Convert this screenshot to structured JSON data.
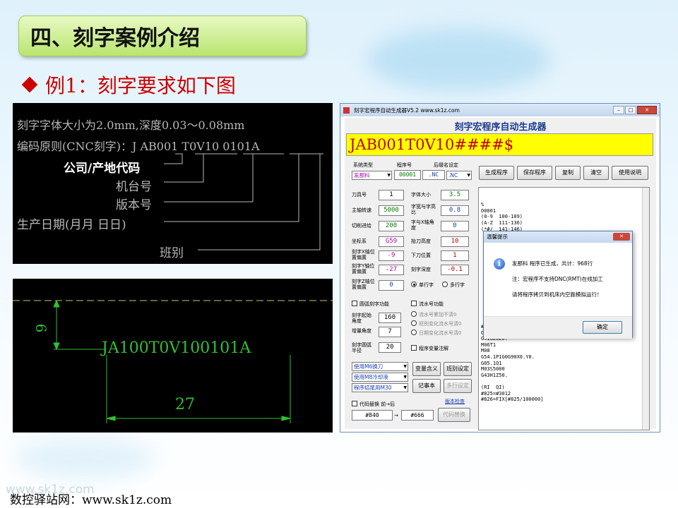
{
  "slide": {
    "title": "四、刻字案例介绍",
    "example_heading": "例1：刻字要求如下图",
    "footer": "数控驿站网：www.sk1z.com",
    "watermark": "www.sk1z.com"
  },
  "figure1": {
    "requirement": "刻字字体大小为2.0mm,深度0.03～0.08mm",
    "code_rule": "编码原则(CNC刻字)：J  AB001  T0V10  0101A",
    "labels": [
      "公司/产地代码",
      "机台号",
      "版本号",
      "生产日期(月月  日日)",
      "班别"
    ]
  },
  "figure2": {
    "text": "JA100T0V100101A",
    "dim_height": "9",
    "dim_width": "27"
  },
  "app": {
    "window_title": "刻字宏程序自动生成器V5.2    www.sk1z.com",
    "heading": "刻字宏程序自动生成器",
    "code_display": "JAB001T0V10####$",
    "header_labels": {
      "system": "系统类型",
      "program_no": "程序号",
      "suffix": "后缀名设定"
    },
    "system_select": "发那科",
    "program_no": "00001",
    "suffix1": ".NC",
    "suffix2": ".NC",
    "buttons": {
      "generate": "生成程序",
      "save": "保存程序",
      "copy": "复制",
      "clear": "清空",
      "help": "使用说明",
      "var_meaning": "变量含义",
      "shift_setting": "班别设定",
      "notepad": "记事本",
      "multiline_setting": "多行设定",
      "replace": "代码替换"
    },
    "fields": [
      {
        "label": "刀具号",
        "value": "1",
        "color": "#000000"
      },
      {
        "label": "主轴转速",
        "value": "5000",
        "color": "#008000"
      },
      {
        "label": "切削进给",
        "value": "200",
        "color": "#008000"
      },
      {
        "label": "坐标系",
        "value": "G59",
        "color": "#b000b0"
      },
      {
        "label": "刻字X轴位置偏置",
        "value": "-9",
        "color": "#b000b0"
      },
      {
        "label": "刻字Y轴位置偏置",
        "value": "-27",
        "color": "#b000b0"
      },
      {
        "label": "刻字Z轴位置偏置",
        "value": "0",
        "color": "#1a40b0"
      }
    ],
    "fields_right": [
      {
        "label": "字体大小",
        "value": "3.5",
        "color": "#008000"
      },
      {
        "label": "字宽与字高比",
        "value": "0.8",
        "color": "#1a40b0"
      },
      {
        "label": "字与X轴角度",
        "value": "0",
        "color": "#1a40b0"
      },
      {
        "label": "抬刀高度",
        "value": "10",
        "color": "#c00000"
      },
      {
        "label": "下刀位置",
        "value": "1",
        "color": "#c00000"
      },
      {
        "label": "刻字深度",
        "value": "-0.1",
        "color": "#c00000"
      }
    ],
    "radio_single": "单行字",
    "radio_multi": "多行字",
    "arc_check": "圆弧刻字功能",
    "arc_start_label": "刻字起始角度",
    "arc_start_value": "160",
    "arc_incr_label": "增量角度",
    "arc_incr_value": "7",
    "arc_radius_label": "刻字圆弧半径",
    "arc_radius_value": "20",
    "serial_check": "流水号功能",
    "serial_opts": [
      "流水号累加不清0",
      "班别变化流水号清0",
      "日期变化流水号清0"
    ],
    "var_note_check": "程序变量注解",
    "dropdowns": [
      "使用M6换刀",
      "使用M8冷却液",
      "程序结尾用M30"
    ],
    "replace_check": "代码替换 前→后",
    "version_link": "版本检查",
    "replace_from": "#840",
    "replace_to": "#666",
    "code_lines_top": [
      "%",
      "O0001",
      "(0-9  100-109)",
      "(A-Z  111-136)",
      "(*#/  141-146)"
    ],
    "code_lines_bottom": [
      "#8=31M(#860)=#5043+#8=G5",
      "G40G80G49G69G17",
      "G91G28Z0.",
      "M06T1",
      "M08",
      "G54.1P1G0G90X0.Y0.",
      "G05.1Q1",
      "M03S5000",
      "G43H1Z50.",
      "",
      "(RI  QI)",
      "#825=#3012",
      "#826=FIX[#825/100000]"
    ]
  },
  "dialog": {
    "title": "温馨提示",
    "line1": "发那科 程序已生成，共计：968行",
    "line2": "注：宏程序不支持DNC(RMT)在线加工",
    "line3": "请将程序拷贝到机床内空跑模拟运行！",
    "ok": "确定"
  }
}
